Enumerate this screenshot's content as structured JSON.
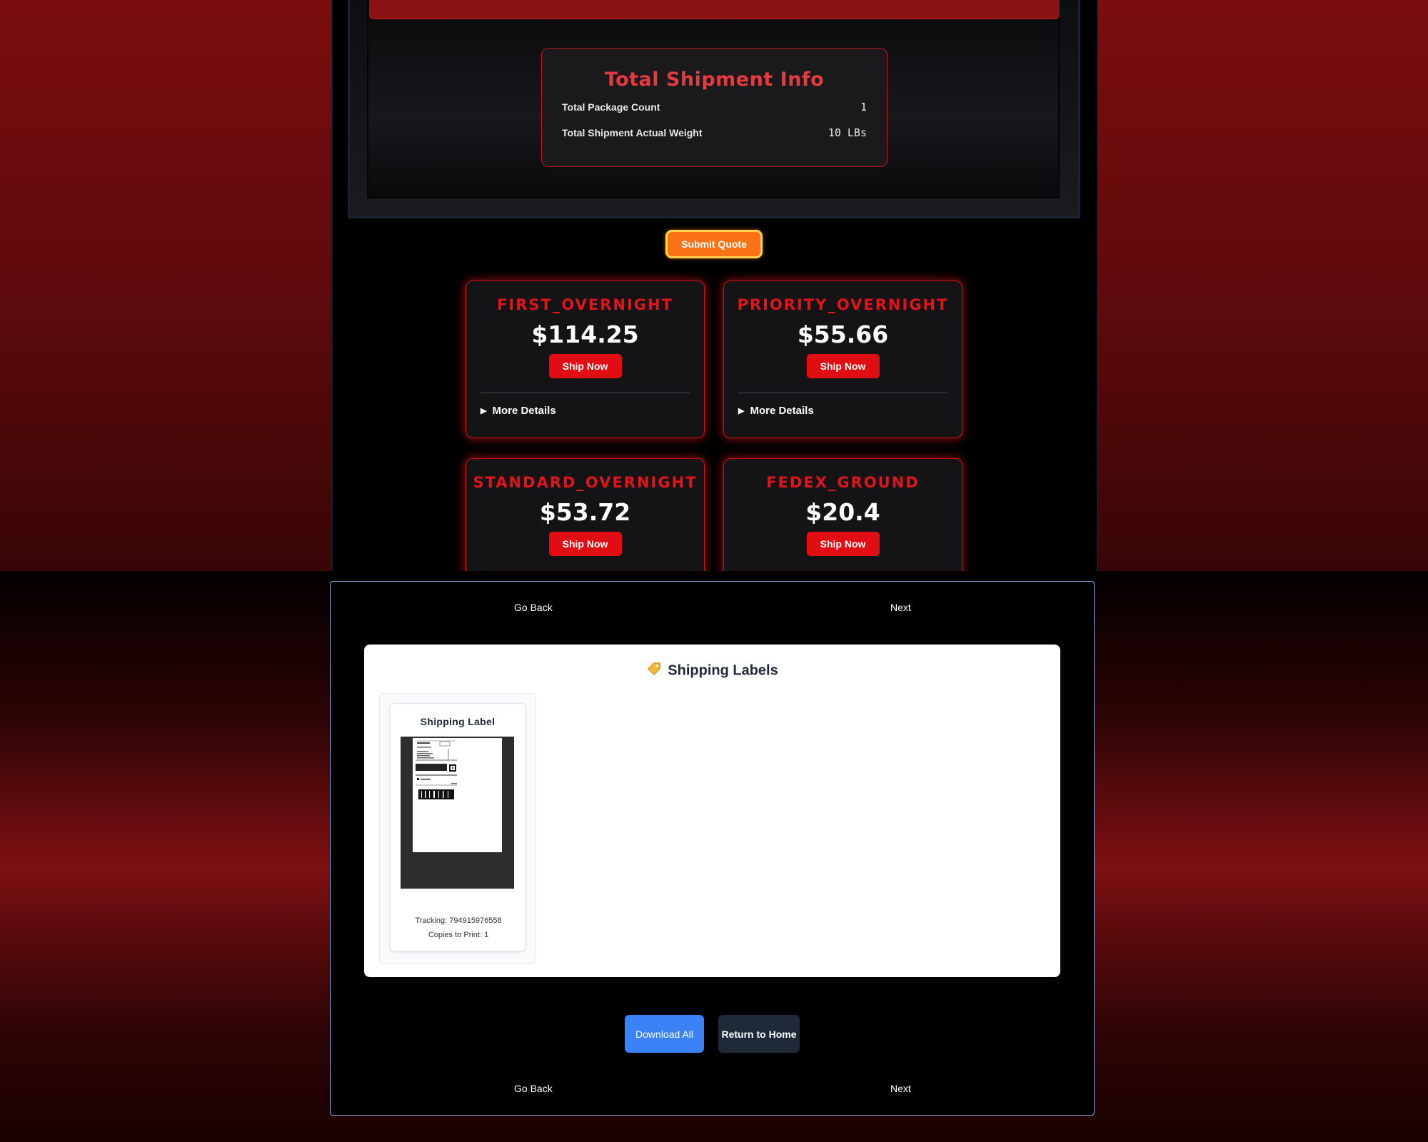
{
  "totals": {
    "title": "Total Shipment Info",
    "rows": [
      {
        "label": "Total Package Count",
        "value": "1"
      },
      {
        "label": "Total Shipment Actual Weight",
        "value": "10 LBs"
      }
    ]
  },
  "submit_label": "Submit Quote",
  "rates": [
    {
      "service": "FIRST_OVERNIGHT",
      "price": "$114.25",
      "ship_label": "Ship Now",
      "details_label": "More Details"
    },
    {
      "service": "PRIORITY_OVERNIGHT",
      "price": "$55.66",
      "ship_label": "Ship Now",
      "details_label": "More Details"
    },
    {
      "service": "STANDARD_OVERNIGHT",
      "price": "$53.72",
      "ship_label": "Ship Now"
    },
    {
      "service": "FEDEX_GROUND",
      "price": "$20.4",
      "ship_label": "Ship Now"
    }
  ],
  "nav": {
    "back": "Go Back",
    "next": "Next"
  },
  "labels_panel": {
    "title": "Shipping Labels",
    "icon": "tag-icon",
    "labels": [
      {
        "title": "Shipping Label",
        "tracking": "Tracking: 794915976558",
        "copies": "Copies to Print: 1"
      }
    ]
  },
  "actions": {
    "download_all": "Download All",
    "return_home": "Return to Home"
  },
  "colors": {
    "accent_red": "#e00d12",
    "submit_orange": "#f97316",
    "download_blue": "#3b82f6"
  }
}
